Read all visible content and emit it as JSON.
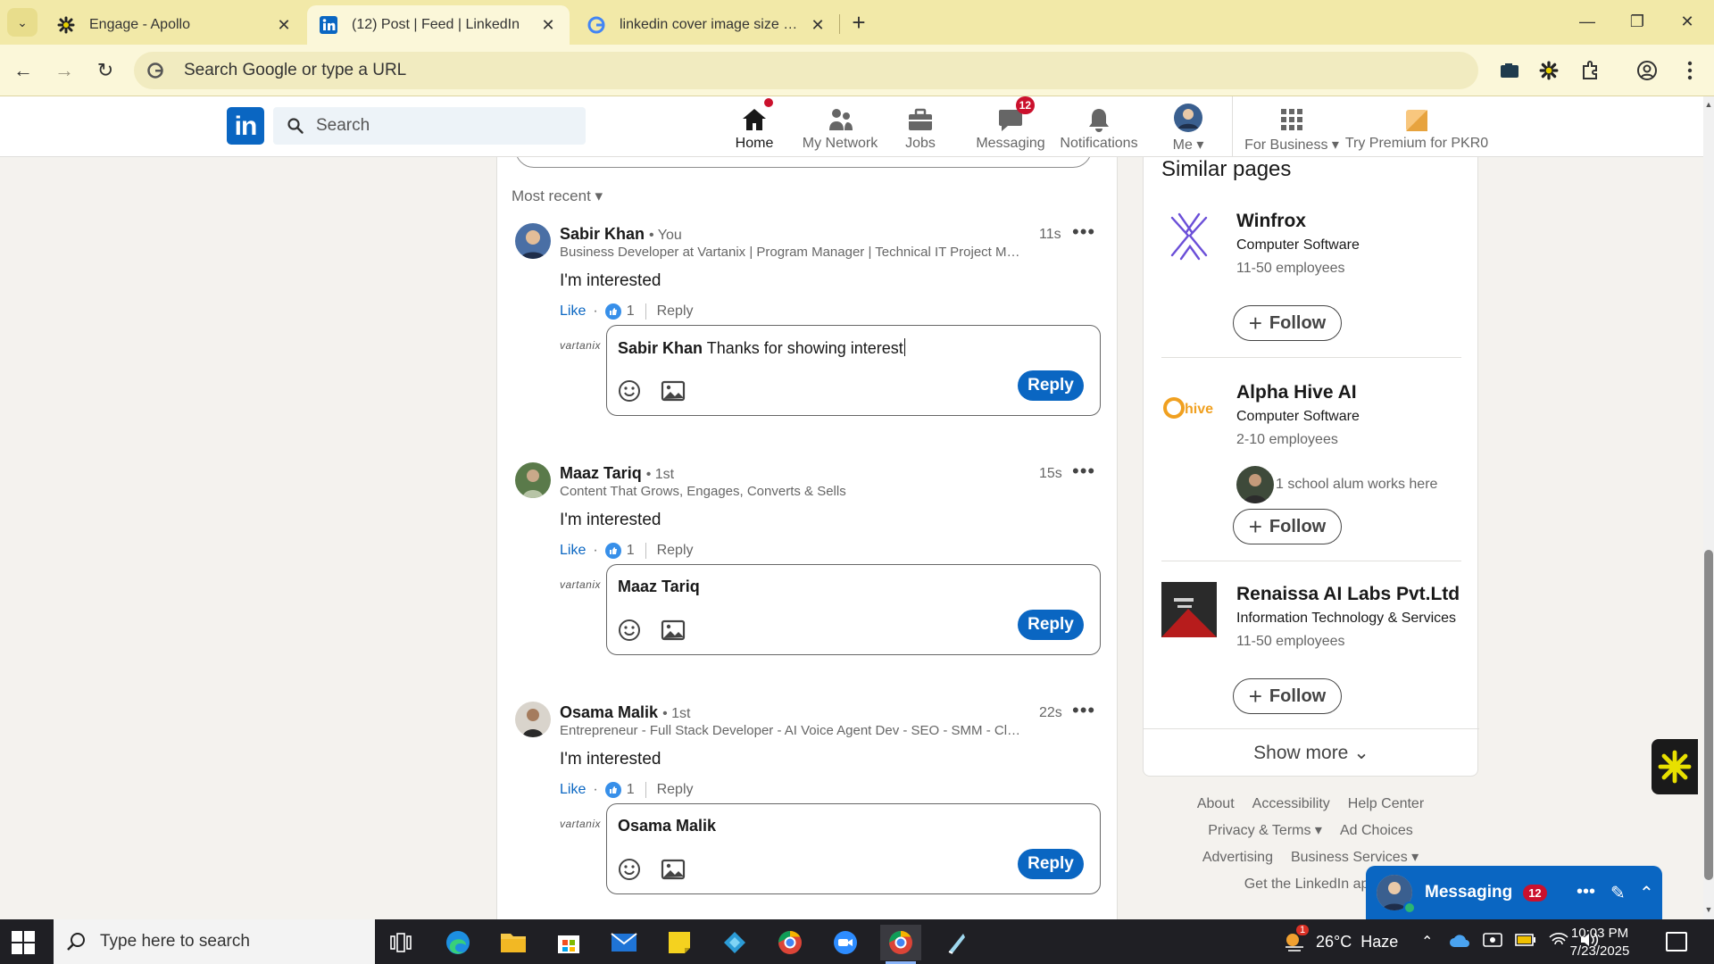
{
  "browser": {
    "tabs": [
      {
        "title": "Engage - Apollo",
        "icon": "apollo-icon"
      },
      {
        "title": "(12) Post | Feed | LinkedIn",
        "icon": "linkedin-icon"
      },
      {
        "title": "linkedin cover image size - Goo",
        "icon": "google-icon"
      }
    ],
    "active_tab": 1,
    "omnibox_placeholder": "Search Google or type a URL"
  },
  "linkedin": {
    "logo_text": "in",
    "search_placeholder": "Search",
    "nav": [
      {
        "label": "Home",
        "icon": "home-icon",
        "badge": "dot"
      },
      {
        "label": "My Network",
        "icon": "network-icon"
      },
      {
        "label": "Jobs",
        "icon": "briefcase-icon"
      },
      {
        "label": "Messaging",
        "icon": "messaging-icon",
        "badge": "12"
      },
      {
        "label": "Notifications",
        "icon": "bell-icon"
      },
      {
        "label": "Me ▾",
        "icon": "avatar-icon"
      },
      {
        "label": "For Business ▾",
        "icon": "grid-icon"
      },
      {
        "label": "Try Premium for PKR0",
        "icon": "premium-icon"
      }
    ]
  },
  "feed": {
    "sort_label": "Most recent",
    "comments": [
      {
        "name": "Sabir Khan",
        "degree": "• You",
        "headline": "Business Developer at Vartanix | Program Manager | Technical IT Project Man...",
        "time": "11s",
        "text": "I'm interested",
        "like_label": "Like",
        "reaction_count": "1",
        "reply_label": "Reply",
        "reply_mention": "Sabir Khan",
        "reply_draft": " Thanks for showing interest",
        "reply_button": "Reply"
      },
      {
        "name": "Maaz Tariq",
        "degree": "• 1st",
        "headline": "Content That Grows, Engages, Converts & Sells",
        "time": "15s",
        "text": "I'm interested",
        "like_label": "Like",
        "reaction_count": "1",
        "reply_label": "Reply",
        "reply_mention": "Maaz Tariq",
        "reply_draft": "",
        "reply_button": "Reply"
      },
      {
        "name": "Osama Malik",
        "degree": "• 1st",
        "headline": "Entrepreneur - Full Stack Developer - AI Voice Agent Dev - SEO - SMM - Clo...",
        "time": "22s",
        "text": "I'm interested",
        "like_label": "Like",
        "reaction_count": "1",
        "reply_label": "Reply",
        "reply_mention": "Osama Malik",
        "reply_draft": "",
        "reply_button": "Reply"
      }
    ],
    "company_logo_text": "vartanix"
  },
  "rail": {
    "title": "Similar pages",
    "pages": [
      {
        "name": "Winfrox",
        "industry": "Computer Software",
        "size": "11-50 employees",
        "alum": "",
        "follow": "Follow"
      },
      {
        "name": "Alpha Hive AI",
        "industry": "Computer Software",
        "size": "2-10 employees",
        "alum": "1 school alum works here",
        "follow": "Follow",
        "logo_text": "hive"
      },
      {
        "name": "Renaissa AI Labs Pvt.Ltd",
        "industry": "Information Technology & Services",
        "size": "11-50 employees",
        "alum": "",
        "follow": "Follow"
      }
    ],
    "show_more": "Show more"
  },
  "footer": {
    "row1": [
      "About",
      "Accessibility",
      "Help Center"
    ],
    "row2": [
      "Privacy & Terms ▾",
      "Ad Choices"
    ],
    "row3": [
      "Advertising",
      "Business Services ▾"
    ],
    "row4": [
      "Get the LinkedIn app"
    ]
  },
  "messaging": {
    "label": "Messaging",
    "count": "12"
  },
  "taskbar": {
    "search_placeholder": "Type here to search",
    "weather": "26°C  Haze",
    "weather_badge": "1",
    "time": "10:03 PM",
    "date": "7/23/2025"
  },
  "colors": {
    "linkedin_blue": "#0a66c2",
    "badge_red": "#cb112d",
    "chrome_yellow": "#f2e9a8"
  }
}
